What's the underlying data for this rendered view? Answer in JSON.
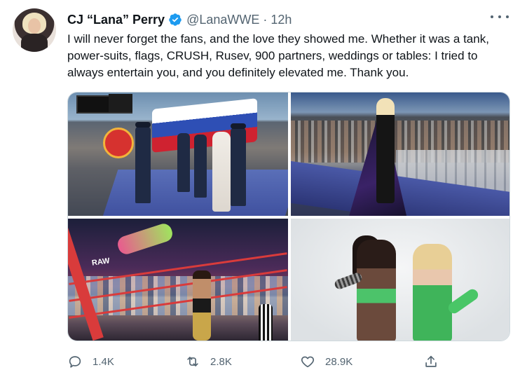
{
  "tweet": {
    "display_name": "CJ “Lana” Perry",
    "handle": "@LanaWWE",
    "separator": "·",
    "time": "12h",
    "text": "I will never forget the fans, and the love they showed me. Whether it was a tank, power-suits, flags, CRUSH, Rusev, 900 partners, weddings or tables: I tried to always entertain you, and you definitely elevated me. Thank you.",
    "verified": true,
    "more_icon": "more-horizontal-icon"
  },
  "media": {
    "photos": [
      {
        "name": "photo-parade-flag"
      },
      {
        "name": "photo-entrance-cape"
      },
      {
        "name": "photo-ring-action",
        "raw_logo": "RAW"
      },
      {
        "name": "photo-studio-pose"
      }
    ]
  },
  "actions": {
    "reply": {
      "icon": "reply-icon",
      "count": "1.4K"
    },
    "retweet": {
      "icon": "retweet-icon",
      "count": "2.8K"
    },
    "like": {
      "icon": "heart-icon",
      "count": "28.9K"
    },
    "share": {
      "icon": "share-icon"
    }
  },
  "colors": {
    "text": "#0f1419",
    "secondary": "#536471",
    "verified": "#1d9bf0",
    "border": "#cfd9de"
  }
}
